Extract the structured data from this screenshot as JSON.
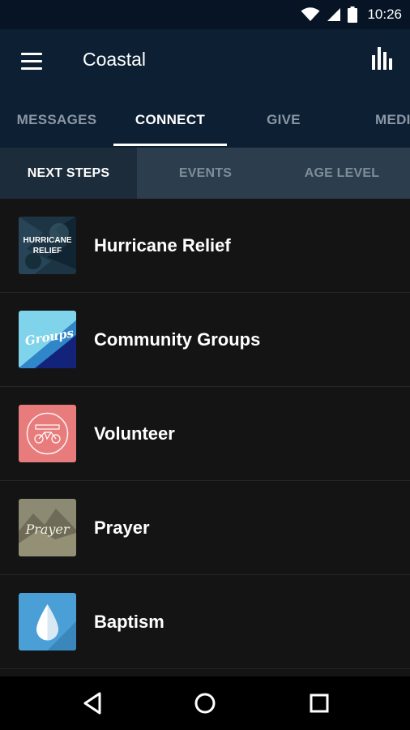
{
  "status_bar": {
    "time": "10:26",
    "icons": [
      "wifi-icon",
      "cellular-signal-icon",
      "battery-icon"
    ]
  },
  "app_bar": {
    "title": "Coastal",
    "menu_icon": "hamburger-menu-icon",
    "action_icon": "bar-chart-icon"
  },
  "main_tabs": [
    {
      "label": "MESSAGES",
      "active": false
    },
    {
      "label": "CONNECT",
      "active": true
    },
    {
      "label": "GIVE",
      "active": false
    },
    {
      "label": "MEDI",
      "active": false
    }
  ],
  "sub_tabs": [
    {
      "label": "NEXT STEPS",
      "active": true
    },
    {
      "label": "EVENTS",
      "active": false
    },
    {
      "label": "AGE LEVEL",
      "active": false
    }
  ],
  "items": [
    {
      "label": "Hurricane Relief",
      "thumb_text": [
        "HURRICANE",
        "RELIEF"
      ],
      "thumb_color": "#1e3a4a"
    },
    {
      "label": "Community Groups",
      "thumb_text": [
        "Groups"
      ],
      "thumb_color": "#2f86c8"
    },
    {
      "label": "Volunteer",
      "thumb_text": [],
      "thumb_color": "#e87c7c"
    },
    {
      "label": "Prayer",
      "thumb_text": [
        "Prayer"
      ],
      "thumb_color": "#8c8a72"
    },
    {
      "label": "Baptism",
      "thumb_text": [],
      "thumb_color": "#4a9fd6"
    }
  ],
  "nav_bar": {
    "icons": [
      "back-icon",
      "home-icon",
      "recents-icon"
    ]
  },
  "colors": {
    "app_bar": "#0c1f33",
    "status_bar": "#071425",
    "sub_tabs": "#2c3d4d",
    "list_bg": "#141414"
  }
}
